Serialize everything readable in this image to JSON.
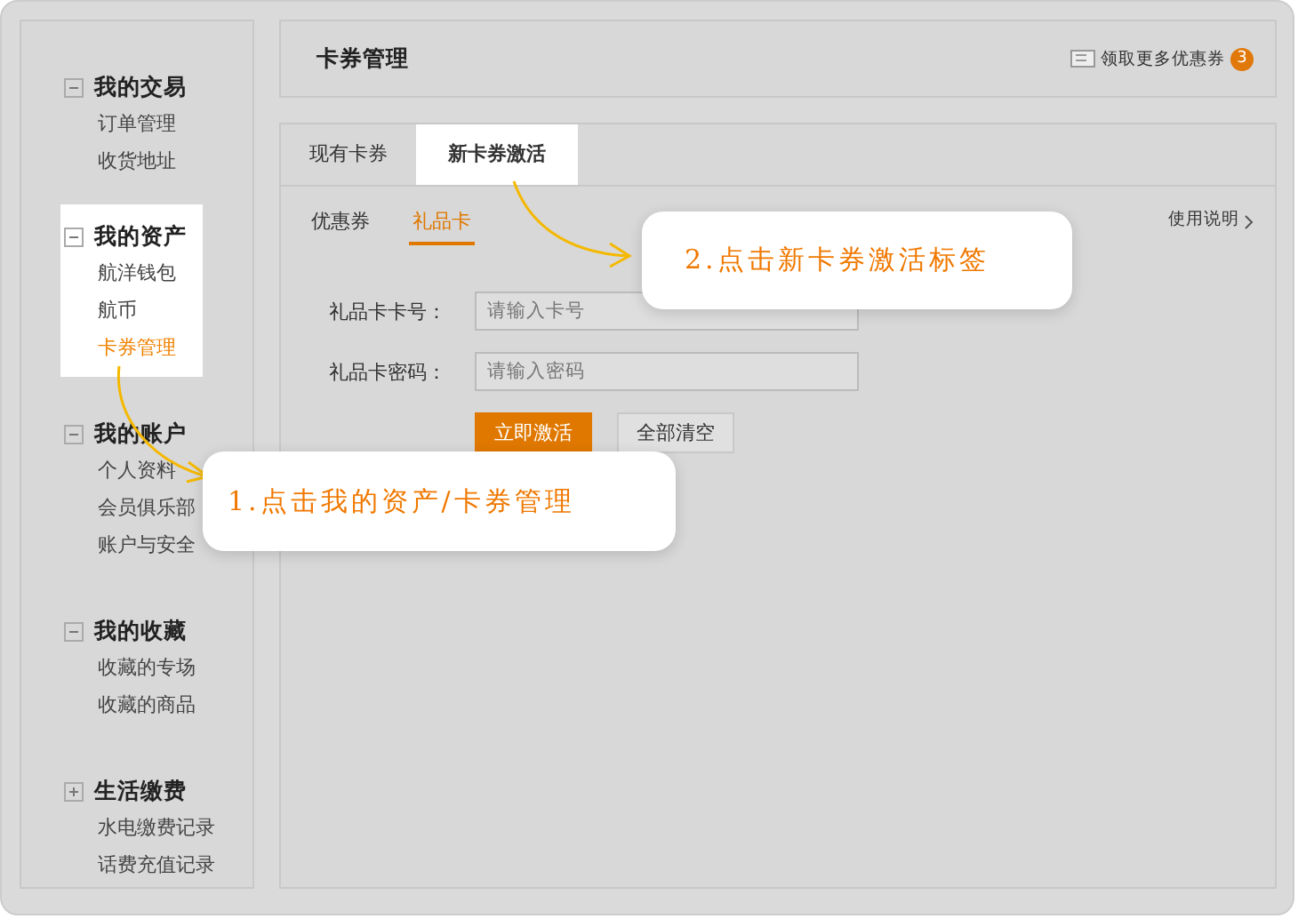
{
  "sidebar": {
    "groups": [
      {
        "title": "我的交易",
        "expanded": true,
        "highlighted": false,
        "items": [
          {
            "label": "订单管理",
            "selected": false
          },
          {
            "label": "收货地址",
            "selected": false
          }
        ]
      },
      {
        "title": "我的资产",
        "expanded": true,
        "highlighted": true,
        "items": [
          {
            "label": "航洋钱包",
            "selected": false
          },
          {
            "label": "航币",
            "selected": false
          },
          {
            "label": "卡券管理",
            "selected": true
          }
        ]
      },
      {
        "title": "我的账户",
        "expanded": true,
        "highlighted": false,
        "items": [
          {
            "label": "个人资料",
            "selected": false
          },
          {
            "label": "会员俱乐部",
            "selected": false
          },
          {
            "label": "账户与安全",
            "selected": false
          }
        ]
      },
      {
        "title": "我的收藏",
        "expanded": true,
        "highlighted": false,
        "items": [
          {
            "label": "收藏的专场",
            "selected": false
          },
          {
            "label": "收藏的商品",
            "selected": false
          }
        ]
      },
      {
        "title": "生活缴费",
        "expanded": false,
        "highlighted": false,
        "items": [
          {
            "label": "水电缴费记录",
            "selected": false
          },
          {
            "label": "话费充值记录",
            "selected": false
          }
        ]
      }
    ]
  },
  "header": {
    "title": "卡券管理",
    "coupon_link": "领取更多优惠券",
    "coupon_count": "3"
  },
  "tabs": [
    {
      "label": "现有卡券",
      "selected": false
    },
    {
      "label": "新卡券激活",
      "selected": true
    }
  ],
  "subtabs": [
    {
      "label": "优惠券",
      "selected": false
    },
    {
      "label": "礼品卡",
      "selected": true
    }
  ],
  "help_link": "使用说明",
  "form": {
    "fields": [
      {
        "label": "礼品卡卡号：",
        "placeholder": "请输入卡号"
      },
      {
        "label": "礼品卡密码：",
        "placeholder": "请输入密码"
      }
    ],
    "buttons": [
      {
        "label": "立即激活",
        "kind": "primary"
      },
      {
        "label": "全部清空",
        "kind": "secondary"
      }
    ]
  },
  "callouts": [
    {
      "text": "1.点击我的资产/卡券管理"
    },
    {
      "text": "2.点击新卡券激活标签"
    }
  ]
}
